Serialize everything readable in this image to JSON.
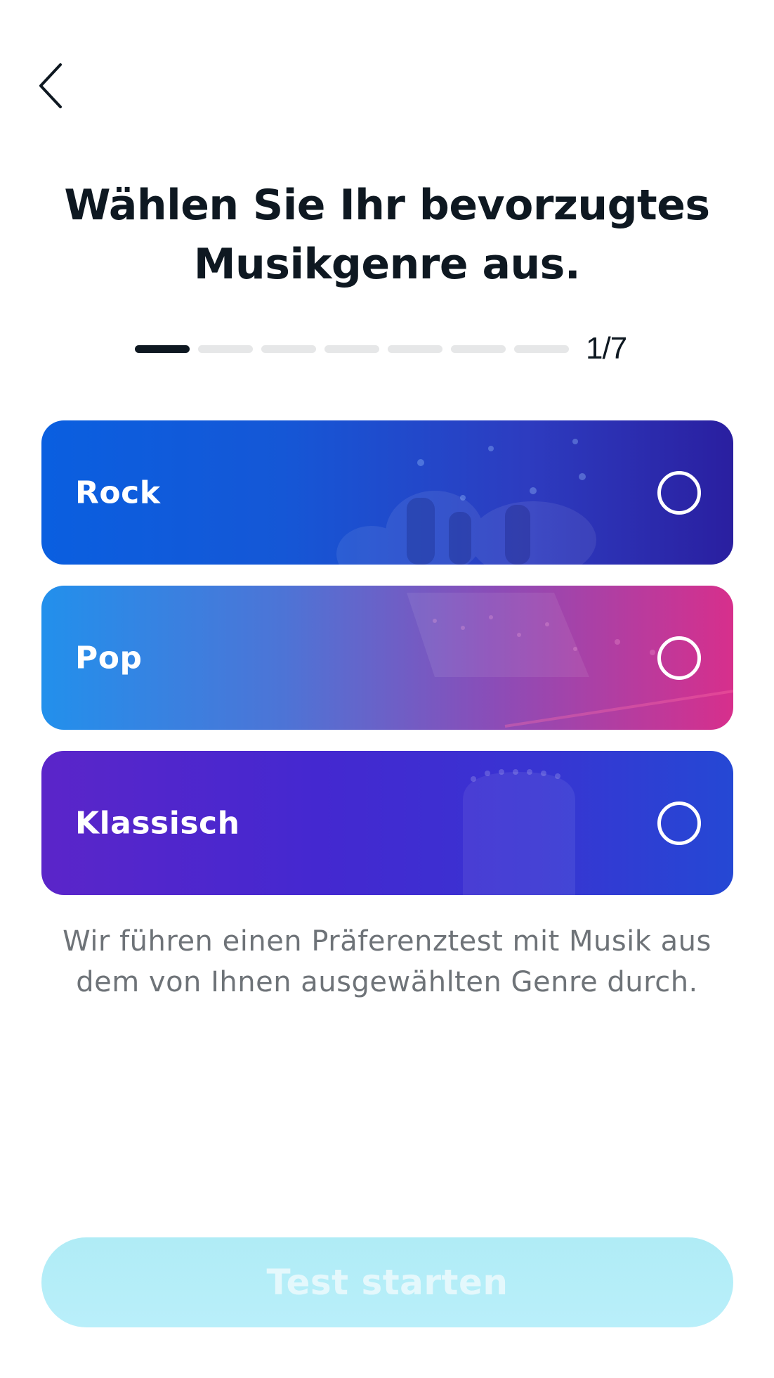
{
  "header": {
    "back_icon": "chevron-left-icon"
  },
  "title": "Wählen Sie Ihr bevorzugtes Musikgenre aus.",
  "progress": {
    "current": 1,
    "total": 7,
    "label": "1/7"
  },
  "genres": [
    {
      "label": "Rock",
      "selected": false,
      "colors": [
        "#0a5fe0",
        "#2a1fa0"
      ]
    },
    {
      "label": "Pop",
      "selected": false,
      "colors": [
        "#2290ec",
        "#d72f8c"
      ]
    },
    {
      "label": "Klassisch",
      "selected": false,
      "colors": [
        "#5b25c9",
        "#2548d4"
      ]
    }
  ],
  "info_text": "Wir führen einen Präferenztest mit Musik aus dem von Ihnen ausgewählten Genre durch.",
  "start_button": {
    "label": "Test starten",
    "enabled": false,
    "color": "#b0ecf6"
  }
}
